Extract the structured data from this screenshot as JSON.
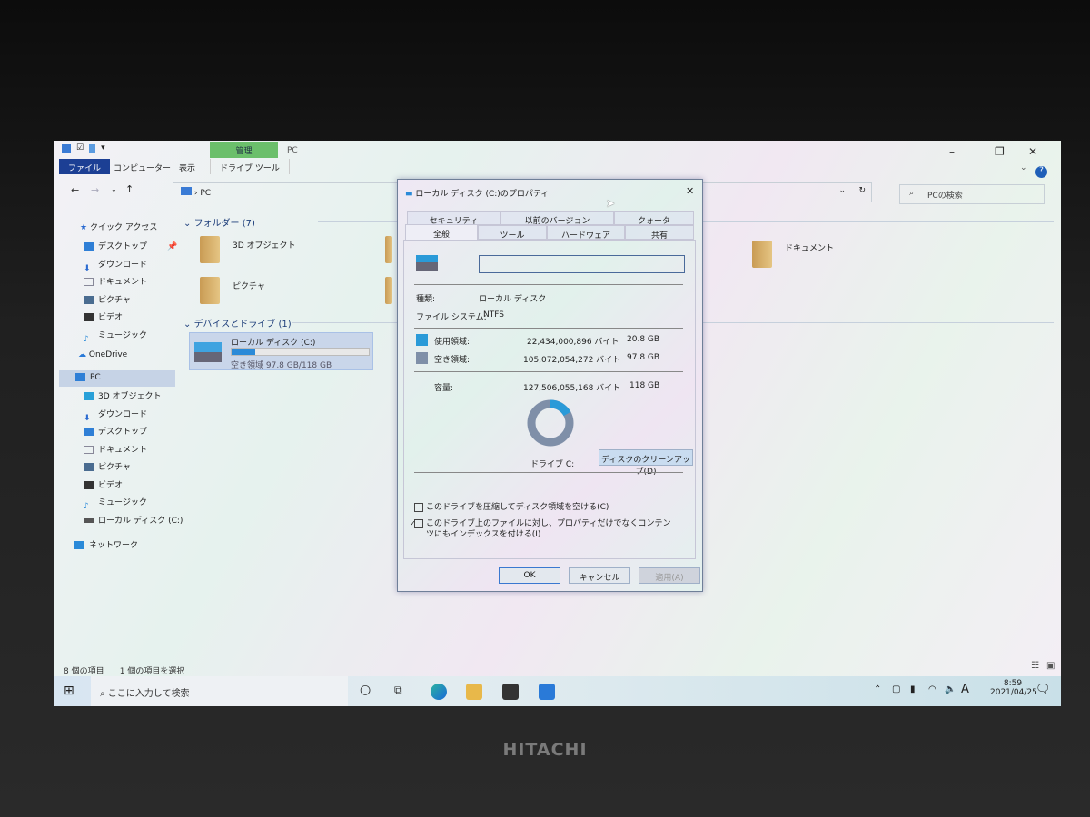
{
  "explorer": {
    "ribbon_tabs": [
      "ファイル",
      "コンピューター",
      "表示",
      "ドライブ ツール"
    ],
    "manage_tab": "管理",
    "window_title": "PC",
    "address": "PC",
    "search_placeholder": "PCの検索",
    "nav": {
      "quick_access": "クイック アクセス",
      "quick_items": [
        "デスクトップ",
        "ダウンロード",
        "ドキュメント",
        "ピクチャ",
        "ビデオ",
        "ミュージック"
      ],
      "onedrive": "OneDrive",
      "pc": "PC",
      "pc_items": [
        "3D オブジェクト",
        "ダウンロード",
        "デスクトップ",
        "ドキュメント",
        "ピクチャ",
        "ビデオ",
        "ミュージック",
        "ローカル ディスク (C:)"
      ],
      "network": "ネットワーク"
    },
    "folders_header": "フォルダー (7)",
    "folders": [
      "3D オブジェクト",
      "ピクチャ",
      "ドキュメント"
    ],
    "devices_header": "デバイスとドライブ (1)",
    "drive": {
      "name": "ローカル ディスク (C:)",
      "free_text": "空き領域 97.8 GB/118 GB",
      "used_fraction": 0.17
    },
    "status": {
      "count": "8 個の項目",
      "selected": "1 個の項目を選択"
    }
  },
  "dialog": {
    "title": "ローカル ディスク (C:)のプロパティ",
    "tabs_back": [
      "セキュリティ",
      "以前のバージョン",
      "クォータ"
    ],
    "tabs_front": [
      "全般",
      "ツール",
      "ハードウェア",
      "共有"
    ],
    "name_value": "",
    "type_label": "種類:",
    "type_value": "ローカル ディスク",
    "fs_label": "ファイル システム:",
    "fs_value": "NTFS",
    "used": {
      "label": "使用領域:",
      "bytes": "22,434,000,896 バイト",
      "size": "20.8 GB",
      "color": "#2a9ad8"
    },
    "free": {
      "label": "空き領域:",
      "bytes": "105,072,054,272 バイト",
      "size": "97.8 GB",
      "color": "#7f8fa8"
    },
    "capacity": {
      "label": "容量:",
      "bytes": "127,506,055,168 バイト",
      "size": "118 GB"
    },
    "drive_label": "ドライブ C:",
    "cleanup_button": "ディスクのクリーンアップ(D)",
    "compress_label": "このドライブを圧縮してディスク領域を空ける(C)",
    "compress_checked": false,
    "index_label": "このドライブ上のファイルに対し、プロパティだけでなくコンテンツにもインデックスを付ける(I)",
    "index_checked": true,
    "ok": "OK",
    "cancel": "キャンセル",
    "apply": "適用(A)"
  },
  "taskbar": {
    "search_placeholder": "ここに入力して検索",
    "time": "8:59",
    "date": "2021/04/25",
    "ime": "A"
  },
  "bezel_logo": "HITACHI"
}
